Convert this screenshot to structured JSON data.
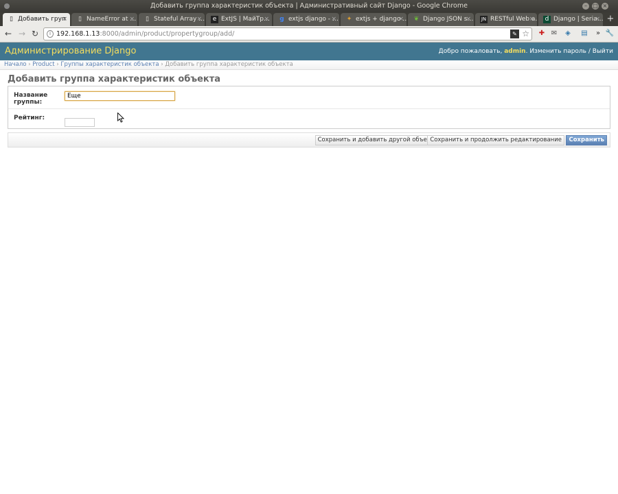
{
  "window": {
    "title": "Добавить группа характеристик объекта | Административный сайт Django - Google Chrome"
  },
  "tabs": [
    {
      "label": "Добавить груп",
      "icon": "page-icon",
      "active": true
    },
    {
      "label": "NameError at …",
      "icon": "page-icon",
      "active": false
    },
    {
      "label": "Stateful Array …",
      "icon": "page-icon",
      "active": false
    },
    {
      "label": "ExtJS | МайТр…",
      "icon": "extjs-icon",
      "active": false
    },
    {
      "label": "extjs django - …",
      "icon": "google-icon",
      "active": false
    },
    {
      "label": "extjs + django …",
      "icon": "google-icon",
      "active": false
    },
    {
      "label": "Django JSON s…",
      "icon": "leaf-icon",
      "active": false
    },
    {
      "label": "RESTful Web a…",
      "icon": "jn-icon",
      "active": false
    },
    {
      "label": "Django | Seria…",
      "icon": "django-icon",
      "active": false
    }
  ],
  "address": {
    "host": "192.168.1.13",
    "rest": ":8000/admin/product/propertygroup/add/"
  },
  "header": {
    "brand": "Администрирование Django",
    "welcome": "Добро пожаловать,",
    "user": "admin",
    "change_password": "Изменить пароль",
    "logout": "Выйти"
  },
  "breadcrumbs": {
    "home": "Начало",
    "app": "Product",
    "model": "Группы характеристик объекта",
    "current": "Добавить группа характеристик объекта",
    "sep": " › "
  },
  "page": {
    "title": "Добавить группа характеристик объекта"
  },
  "form": {
    "name_label": "Название группы:",
    "name_value": "Еще",
    "rating_label": "Рейтинг:",
    "rating_value": ""
  },
  "buttons": {
    "save_add_another": "Сохранить и добавить другой объект",
    "save_continue": "Сохранить и продолжить редактирование",
    "save": "Сохранить"
  },
  "colors": {
    "header_bg": "#417690",
    "brand_yellow": "#f5dd5d",
    "link_blue": "#5b80b2"
  }
}
